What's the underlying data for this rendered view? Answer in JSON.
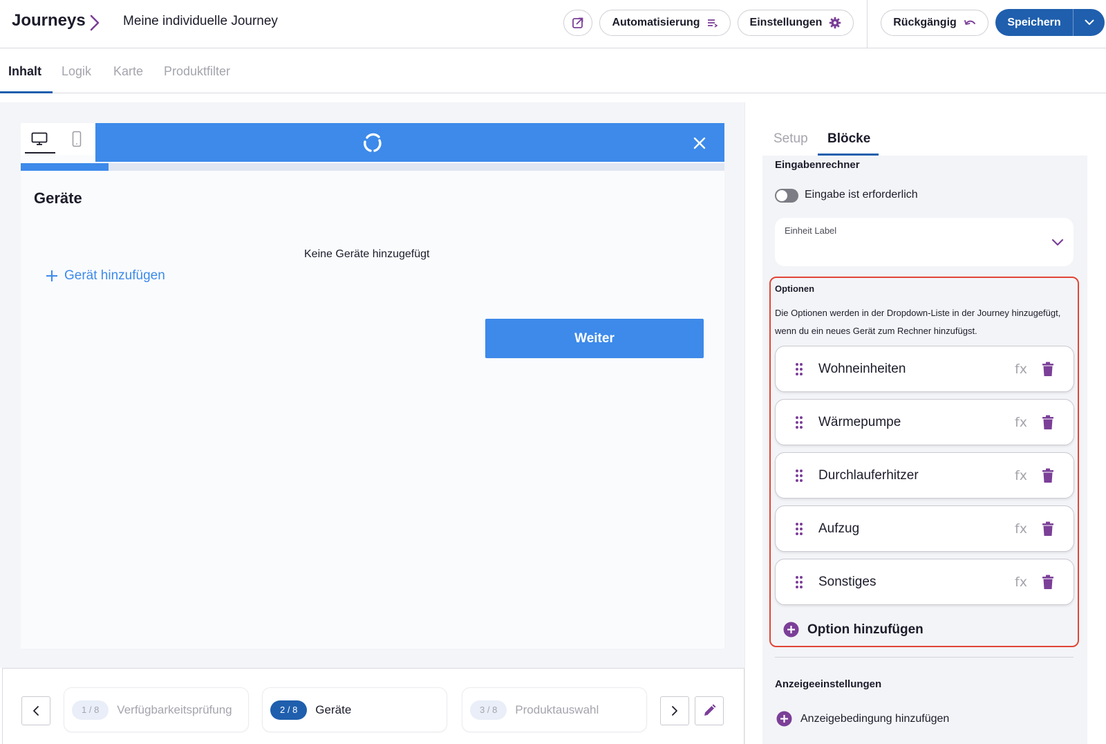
{
  "header": {
    "brand": "Journeys",
    "journey_title": "Meine individuelle Journey",
    "automation_label": "Automatisierung",
    "settings_label": "Einstellungen",
    "undo_label": "Rückgängig",
    "save_label": "Speichern"
  },
  "tabs": [
    {
      "label": "Inhalt",
      "active": true
    },
    {
      "label": "Logik",
      "active": false
    },
    {
      "label": "Karte",
      "active": false
    },
    {
      "label": "Produktfilter",
      "active": false
    }
  ],
  "preview": {
    "progress_fraction": 0.125,
    "step_title": "Geräte",
    "empty_text": "Keine Geräte hinzugefügt",
    "add_device_label": "Gerät hinzufügen",
    "next_label": "Weiter"
  },
  "steps": [
    {
      "pill": "1 / 8",
      "name": "Verfügbarkeitsprüfung",
      "active": false
    },
    {
      "pill": "2 / 8",
      "name": "Geräte",
      "active": true
    },
    {
      "pill": "3 / 8",
      "name": "Produktauswahl",
      "active": false
    }
  ],
  "panel": {
    "tabs": [
      {
        "label": "Setup",
        "active": false
      },
      {
        "label": "Blöcke",
        "active": true
      }
    ],
    "block_title": "Eingabenrechner",
    "required_toggle_label": "Eingabe ist erforderlich",
    "required_toggle_on": false,
    "unit_select_label": "Einheit Label",
    "options_title": "Optionen",
    "options_description": "Die Optionen werden in der Dropdown-Liste in der Journey hinzugefügt, wenn du ein neues Gerät zum Rechner hinzufügst.",
    "options": [
      {
        "label": "Wohneinheiten",
        "fx": "fx"
      },
      {
        "label": "Wärmepumpe",
        "fx": "fx"
      },
      {
        "label": "Durchlauferhitzer",
        "fx": "fx"
      },
      {
        "label": "Aufzug",
        "fx": "fx"
      },
      {
        "label": "Sonstiges",
        "fx": "fx"
      }
    ],
    "add_option_label": "Option hinzufügen",
    "display_settings_title": "Anzeigeeinstellungen",
    "add_condition_label": "Anzeigebedingung hinzufügen"
  },
  "colors": {
    "primary_blue": "#1f5fad",
    "preview_blue": "#3d8aea",
    "accent_purple": "#7b3f98",
    "highlight_red": "#e04535"
  },
  "icons": [
    "chevron-right-icon",
    "external-link-icon",
    "list-icon",
    "gear-icon",
    "undo-icon",
    "chevron-down-icon",
    "desktop-icon",
    "mobile-icon",
    "logo-icon",
    "close-icon",
    "plus-icon",
    "drag-handle-icon",
    "trash-icon",
    "plus-circle-icon",
    "pencil-icon"
  ]
}
